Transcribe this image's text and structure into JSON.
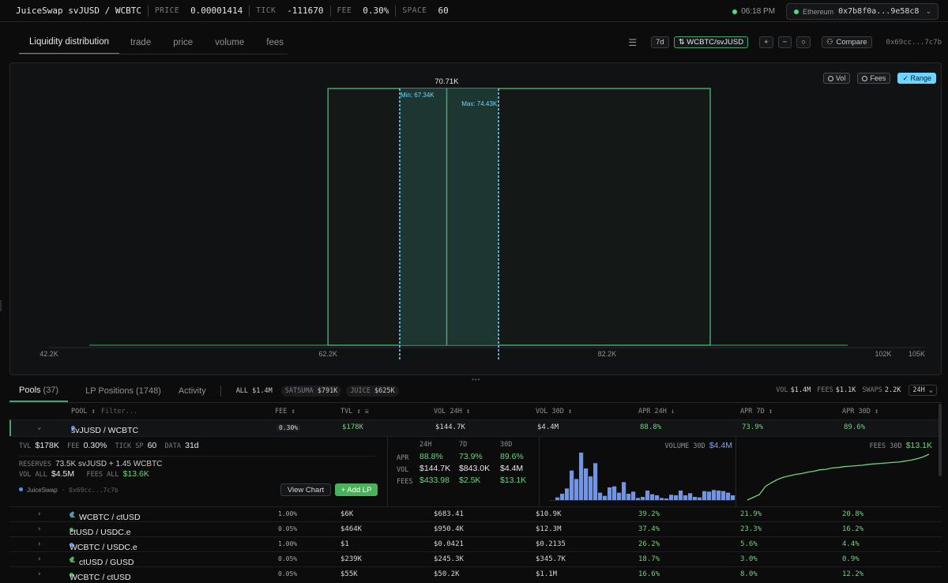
{
  "topbar": {
    "pair": "JuiceSwap svJUSD / WCBTC",
    "price_label": "PRICE",
    "price": "0.00001414",
    "tick_label": "TICK",
    "tick": "-111670",
    "fee_label": "FEE",
    "fee": "0.30%",
    "space_label": "SPACE",
    "space": "60",
    "time": "06:18 PM",
    "network": "Ethereum",
    "wallet": "0x7b8f0a...9e58c8"
  },
  "chart_tabs": [
    "Liquidity distribution",
    "trade",
    "price",
    "volume",
    "fees"
  ],
  "chart_tools": {
    "period": "7d",
    "direction": "⇅ WCBTC/svJUSD",
    "zoom_in": "+",
    "zoom_out": "−",
    "reset": "○",
    "compare": "Compare",
    "pool_address": "0x69cc...7c7b"
  },
  "toggles": [
    {
      "label": "Vol",
      "on": false
    },
    {
      "label": "Fees",
      "on": false
    },
    {
      "label": "✓ Range",
      "on": true
    }
  ],
  "liquidity": {
    "peak_label": "70.71K",
    "min_label": "Min: 67.34K",
    "max_label": "Max: 74.43K",
    "x_ticks": [
      "42.2K",
      "62.2K",
      "82.2K",
      "102K",
      "105K"
    ],
    "x_tick_values": [
      42.2,
      62.2,
      82.2,
      102,
      105
    ],
    "x_range": [
      42.2,
      105
    ],
    "bar_range": [
      62.2,
      89.6
    ],
    "selected_range": [
      67.34,
      74.43
    ],
    "current_price": 70.71,
    "colors": {
      "line": "#3fa96b",
      "range": "#6dd5ff",
      "fill": "#1e3a35"
    }
  },
  "pools_tabs": [
    {
      "label": "Pools",
      "count": "(37)"
    },
    {
      "label": "LP Positions",
      "count": "(1748)"
    },
    {
      "label": "Activity",
      "count": ""
    }
  ],
  "chips": [
    {
      "label": "ALL",
      "value": "$1.4M"
    },
    {
      "label": "SATSUMA",
      "value": "$791K"
    },
    {
      "label": "JUICE",
      "value": "$625K"
    }
  ],
  "summary": {
    "vol_label": "VOL",
    "vol": "$1.4M",
    "fees_label": "FEES",
    "fees": "$1.1K",
    "swaps_label": "SWAPS",
    "swaps": "2.2K",
    "range": "24H"
  },
  "table": {
    "headers": [
      "POOL ↕",
      "Filter...",
      "FEE ↕",
      "TVL ↕ ⩸",
      "VOL 24H ↕",
      "VOL 30D ↕",
      "APR 24H ↓",
      "APR 7D ↕",
      "APR 30D ↕"
    ],
    "selected": {
      "pool": "svJUSD / WCBTC",
      "fee": "0.30%",
      "tvl": "$178K",
      "vol24": "$144.7K",
      "vol30": "$4.4M",
      "apr24": "88.8%",
      "apr7": "73.9%",
      "apr30": "89.6%"
    },
    "rows": [
      {
        "pool": "WCBTC / ctUSD",
        "fee": "1.00%",
        "tvl": "$6K",
        "vol24": "$683.41",
        "vol30": "$10.9K",
        "apr24": "39.2%",
        "apr7": "21.9%",
        "apr30": "20.8%",
        "color": "#5b8def",
        "user": true
      },
      {
        "pool": "ctUSD / USDC.e",
        "fee": "0.05%",
        "tvl": "$464K",
        "vol24": "$950.4K",
        "vol30": "$12.3M",
        "apr24": "37.4%",
        "apr7": "23.3%",
        "apr30": "16.2%",
        "color": "#49b35a",
        "user": false
      },
      {
        "pool": "WCBTC / USDC.e",
        "fee": "1.00%",
        "tvl": "$1",
        "vol24": "$0.0421",
        "vol30": "$0.2135",
        "apr24": "26.2%",
        "apr7": "5.6%",
        "apr30": "4.4%",
        "color": "#5b8def",
        "user": false
      },
      {
        "pool": "ctUSD / GUSD",
        "fee": "0.05%",
        "tvl": "$239K",
        "vol24": "$245.3K",
        "vol30": "$345.7K",
        "apr24": "18.7%",
        "apr7": "3.0%",
        "apr30": "0.9%",
        "color": "#49b35a",
        "user": true
      },
      {
        "pool": "WCBTC / ctUSD",
        "fee": "0.05%",
        "tvl": "$55K",
        "vol24": "$50.2K",
        "vol30": "$1.1M",
        "apr24": "16.6%",
        "apr7": "8.0%",
        "apr30": "12.2%",
        "color": "#49b35a",
        "user": false
      }
    ]
  },
  "detail": {
    "tvl_label": "TVL",
    "tvl": "$178K",
    "fee_label": "FEE",
    "fee": "0.30%",
    "tick_label": "TICK SP",
    "tick": "60",
    "data_label": "DATA",
    "data": "31d",
    "reserves_label": "RESERVES",
    "reserves": "73.5K svJUSD  +  1.45 WCBTC",
    "volall_label": "VOL ALL",
    "volall": "$4.5M",
    "feesall_label": "FEES ALL",
    "feesall": "$13.6K",
    "dex": "JuiceSwap",
    "address": "· 0x69cc...7c7b",
    "view_chart": "View Chart",
    "add_lp": "+ Add LP",
    "grid_headers": [
      "24H",
      "7D",
      "30D"
    ],
    "grid_rows": [
      {
        "label": "APR",
        "values": [
          "88.8%",
          "73.9%",
          "89.6%"
        ],
        "green": true
      },
      {
        "label": "VOL",
        "values": [
          "$144.7K",
          "$843.0K",
          "$4.4M"
        ],
        "green": false
      },
      {
        "label": "FEES",
        "values": [
          "$433.98",
          "$2.5K",
          "$13.1K"
        ],
        "green": true
      }
    ],
    "volume30_label": "VOLUME 30D",
    "volume30": "$4.4M",
    "fees30_label": "FEES 30D",
    "fees30": "$13.1K",
    "volume_bars": [
      5,
      12,
      22,
      56,
      40,
      90,
      60,
      45,
      70,
      14,
      8,
      24,
      26,
      14,
      34,
      12,
      16,
      4,
      6,
      18,
      11,
      9,
      4,
      3,
      10,
      9,
      18,
      9,
      13,
      6,
      5,
      17,
      16,
      19,
      18,
      17,
      14,
      9
    ],
    "fees_curve": [
      0,
      6,
      12,
      30,
      38,
      45,
      50,
      53,
      56,
      58,
      61,
      63,
      66,
      67,
      70,
      71,
      73,
      74,
      75,
      76,
      78,
      79,
      80,
      81,
      82,
      83,
      85,
      87,
      90,
      94,
      100
    ]
  }
}
